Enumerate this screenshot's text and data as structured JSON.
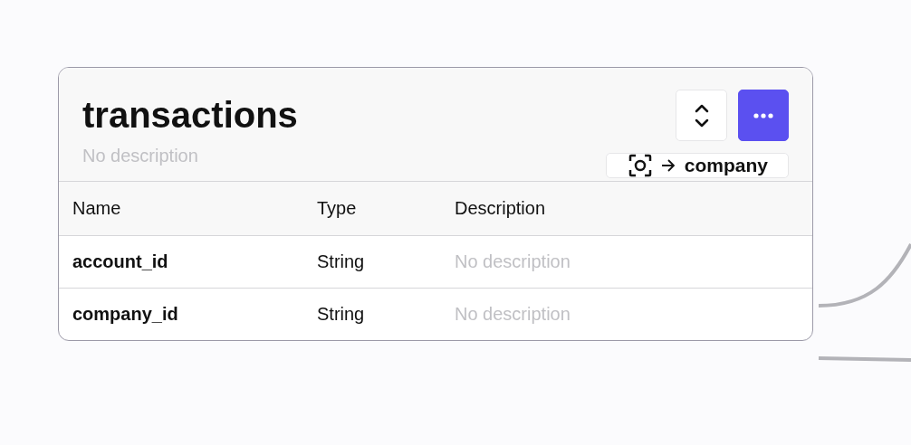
{
  "table_node": {
    "title": "transactions",
    "description": "No description",
    "relation": {
      "target": "company"
    },
    "columns": [
      "Name",
      "Type",
      "Description"
    ],
    "rows": [
      {
        "name": "account_id",
        "type": "String",
        "description": "No description"
      },
      {
        "name": "company_id",
        "type": "String",
        "description": "No description"
      }
    ]
  }
}
